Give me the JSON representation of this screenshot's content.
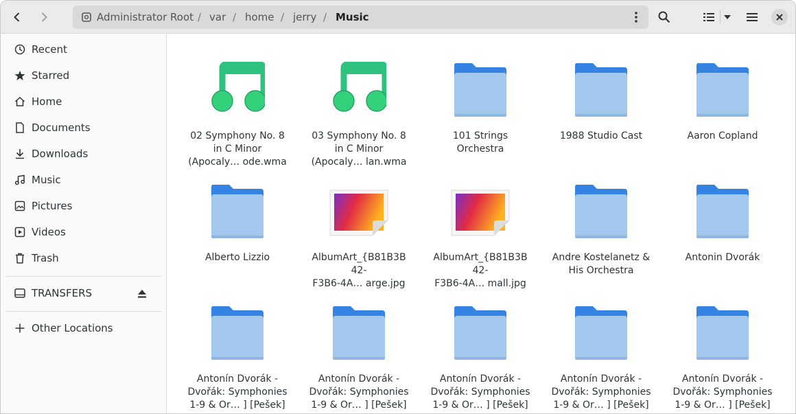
{
  "header": {
    "path": [
      "Administrator Root",
      "var",
      "home",
      "jerry",
      "Music"
    ],
    "icons": [
      "back-icon",
      "forward-icon",
      "drive-icon",
      "kebab-menu-icon",
      "search-icon",
      "list-view-icon",
      "view-options-icon",
      "hamburger-menu-icon",
      "close-icon"
    ]
  },
  "sidebar": {
    "items": [
      {
        "label": "Recent",
        "icon": "clock-icon"
      },
      {
        "label": "Starred",
        "icon": "star-icon"
      },
      {
        "label": "Home",
        "icon": "home-icon"
      },
      {
        "label": "Documents",
        "icon": "document-icon"
      },
      {
        "label": "Downloads",
        "icon": "download-icon"
      },
      {
        "label": "Music",
        "icon": "music-icon"
      },
      {
        "label": "Pictures",
        "icon": "picture-icon"
      },
      {
        "label": "Videos",
        "icon": "video-icon"
      },
      {
        "label": "Trash",
        "icon": "trash-icon"
      }
    ],
    "devices": [
      {
        "label": "TRANSFERS",
        "icon": "drive-icon",
        "action_icon": "eject-icon"
      }
    ],
    "other": {
      "label": "Other Locations",
      "icon": "plus-icon"
    }
  },
  "files": [
    {
      "label": "02 Symphony No. 8\nin C Minor\n(Apocaly… ode.wma",
      "type": "audio"
    },
    {
      "label": "03 Symphony No. 8\nin C Minor\n(Apocaly… lan.wma",
      "type": "audio"
    },
    {
      "label": "101 Strings\nOrchestra",
      "type": "folder"
    },
    {
      "label": "1988 Studio Cast",
      "type": "folder"
    },
    {
      "label": "Aaron Copland",
      "type": "folder"
    },
    {
      "label": "Alberto Lizzio",
      "type": "folder"
    },
    {
      "label": "AlbumArt_{B81B3B\n42-\nF3B6-4A… arge.jpg",
      "type": "image"
    },
    {
      "label": "AlbumArt_{B81B3B\n42-\nF3B6-4A… mall.jpg",
      "type": "image"
    },
    {
      "label": "Andre Kostelanetz &\nHis Orchestra",
      "type": "folder"
    },
    {
      "label": "Antonin Dvorák",
      "type": "folder"
    },
    {
      "label": "Antonín Dvorák -\nDvořák: Symphonies\n1-9 & Or… ] [Pešek]",
      "type": "folder"
    },
    {
      "label": "Antonín Dvorák -\nDvořák: Symphonies\n1-9 & Or… ] [Pešek]",
      "type": "folder"
    },
    {
      "label": "Antonín Dvorák -\nDvořák: Symphonies\n1-9 & Or… ] [Pešek]",
      "type": "folder"
    },
    {
      "label": "Antonín Dvorák -\nDvořák: Symphonies\n1-9 & Or… ] [Pešek]",
      "type": "folder"
    },
    {
      "label": "Antonín Dvorák -\nDvořák: Symphonies\n1-9 & Or… ] [Pešek]",
      "type": "folder"
    }
  ]
}
